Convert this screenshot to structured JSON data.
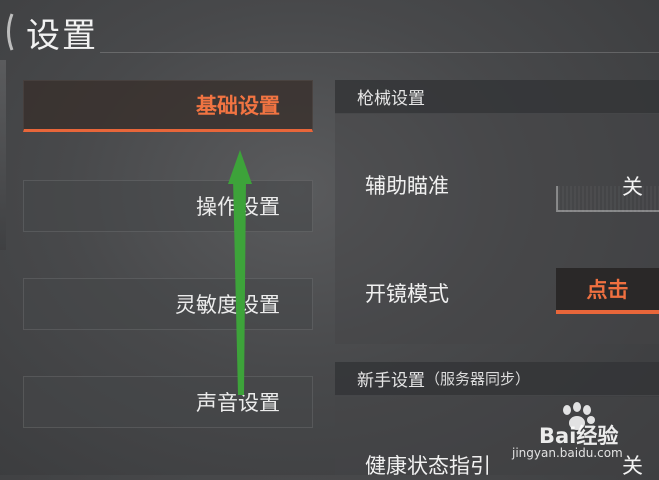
{
  "header": {
    "title": "设置"
  },
  "nav": {
    "items": [
      {
        "label": "基础设置",
        "active": true
      },
      {
        "label": "操作设置",
        "active": false
      },
      {
        "label": "灵敏度设置",
        "active": false
      },
      {
        "label": "声音设置",
        "active": false
      }
    ]
  },
  "sections": {
    "weapon": {
      "title": "枪械设置",
      "rows": [
        {
          "label": "辅助瞄准",
          "value": "关"
        },
        {
          "label": "开镜模式",
          "value": "点击"
        }
      ]
    },
    "newbie": {
      "title": "新手设置",
      "subtitle": "（服务器同步）",
      "rows": [
        {
          "label": "健康状态指引",
          "value": "关"
        }
      ]
    }
  },
  "watermark": {
    "brand": "Bai",
    "suffix": "经验",
    "url": "jingyan.baidu.com"
  },
  "colors": {
    "accent": "#e8663a",
    "arrow": "#3da33a",
    "background": "#48494b"
  }
}
